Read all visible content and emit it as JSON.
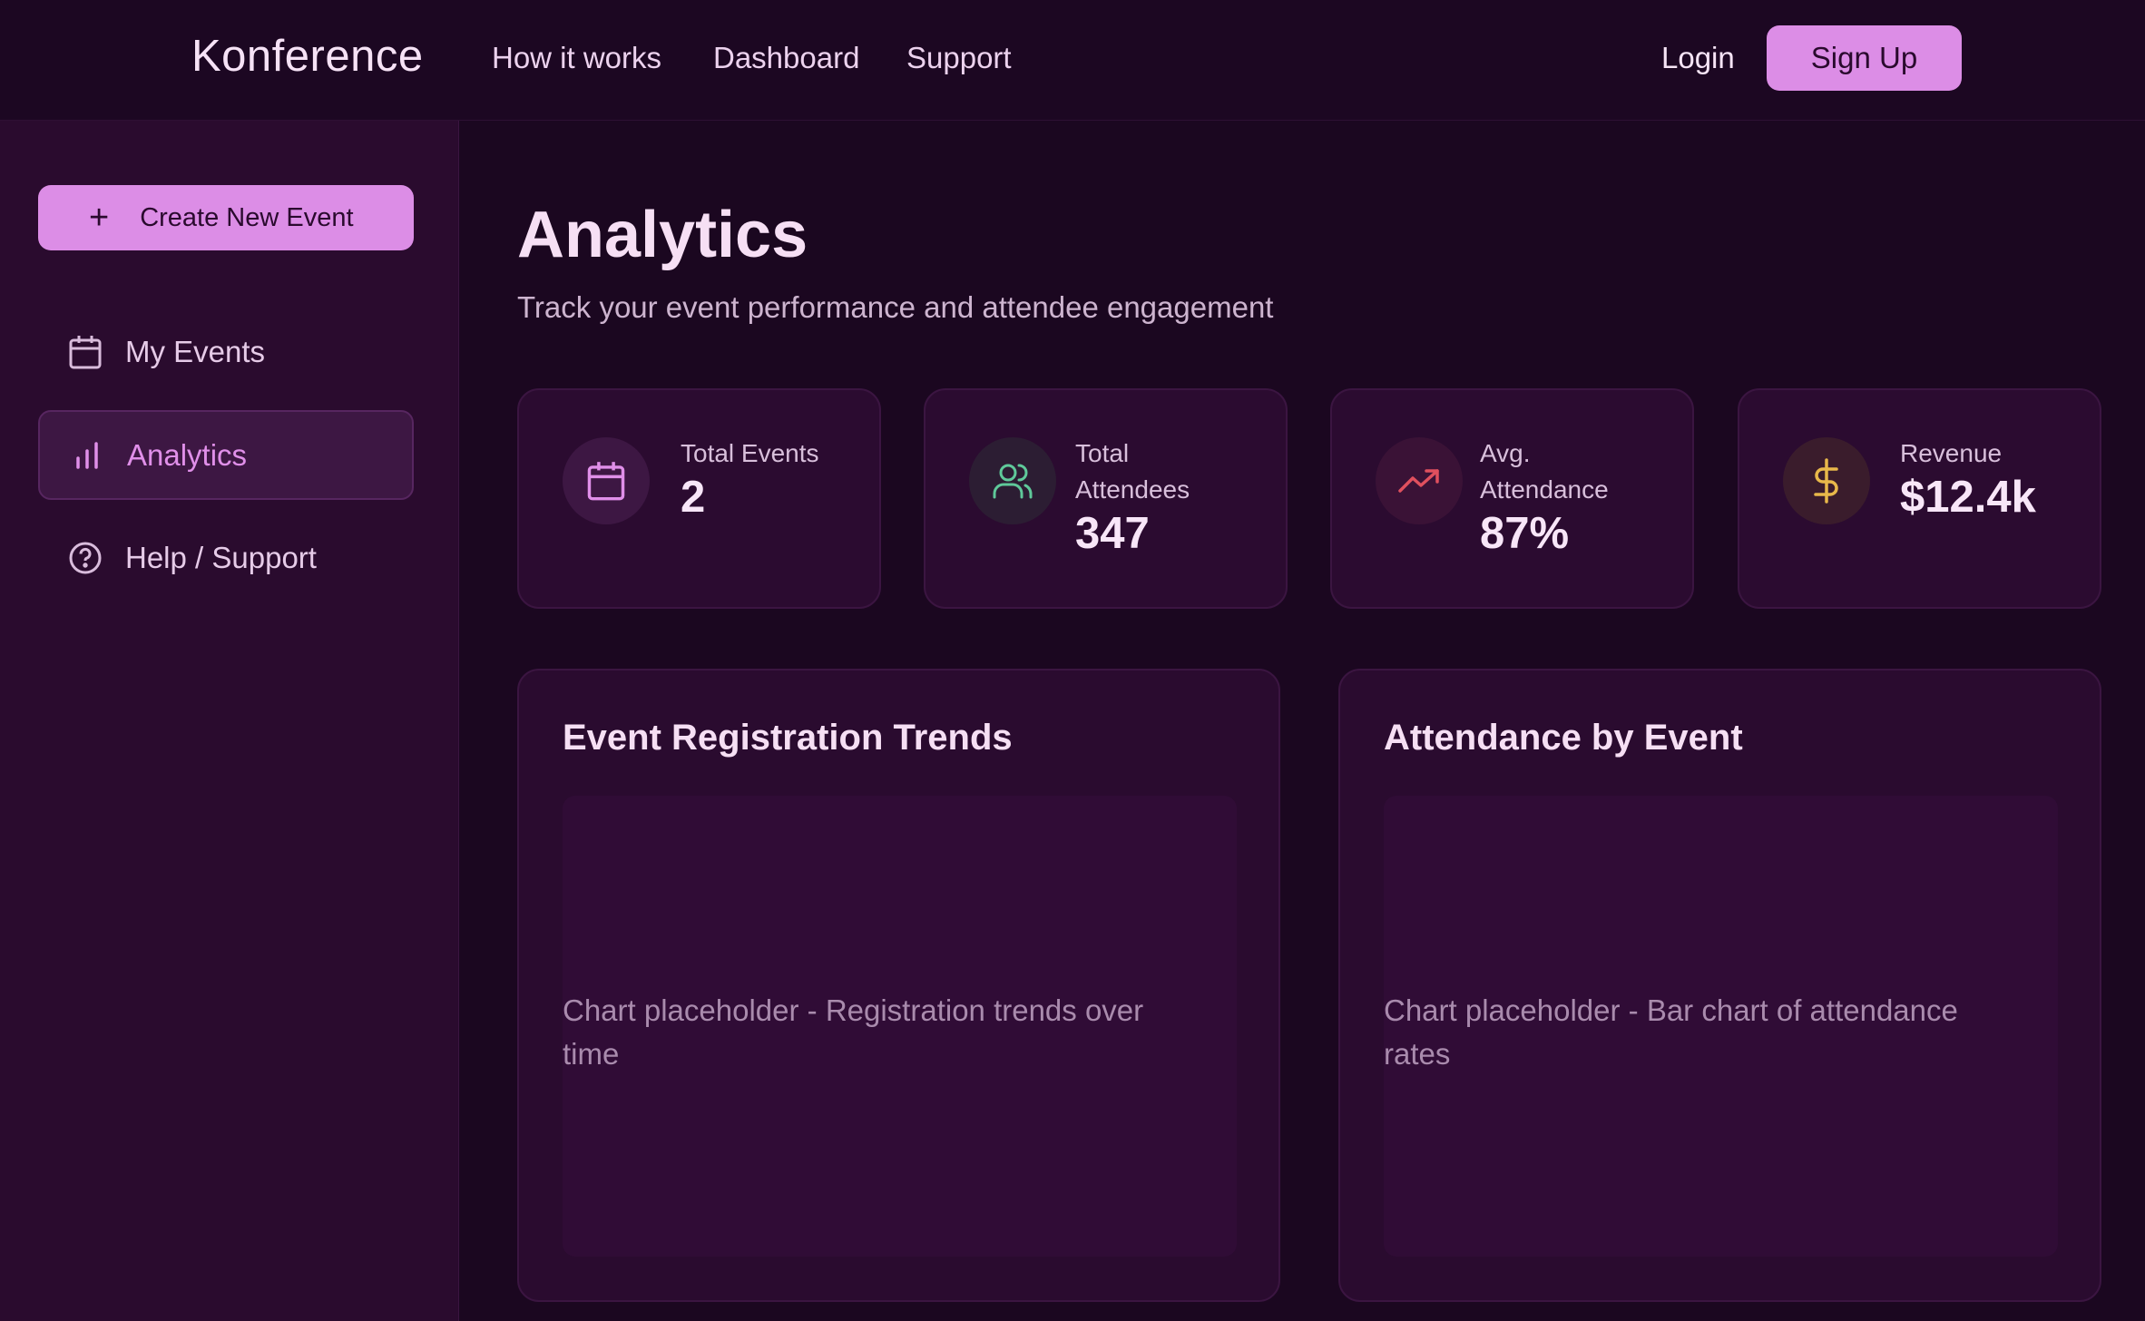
{
  "header": {
    "logo": "Konference",
    "nav": [
      "How it works",
      "Dashboard",
      "Support"
    ],
    "login": "Login",
    "signup": "Sign Up"
  },
  "sidebar": {
    "create_button": "Create New Event",
    "items": [
      {
        "label": "My Events",
        "icon": "calendar-icon",
        "active": false
      },
      {
        "label": "Analytics",
        "icon": "bar-chart-icon",
        "active": true
      },
      {
        "label": "Help / Support",
        "icon": "help-circle-icon",
        "active": false
      }
    ]
  },
  "main": {
    "title": "Analytics",
    "subtitle": "Track your event performance and attendee engagement",
    "stats": [
      {
        "label_line1": "Total Events",
        "label_line2": "",
        "value": "2",
        "icon": "calendar-icon",
        "color": "#e08fe9"
      },
      {
        "label_line1": "Total",
        "label_line2": "Attendees",
        "value": "347",
        "icon": "users-icon",
        "color": "#5fc99a"
      },
      {
        "label_line1": "Avg.",
        "label_line2": "Attendance",
        "value": "87%",
        "icon": "trending-up-icon",
        "color": "#e0505e"
      },
      {
        "label_line1": "Revenue",
        "label_line2": "",
        "value": "$12.4k",
        "icon": "dollar-icon",
        "color": "#e8b84a"
      }
    ],
    "panels": [
      {
        "title": "Event Registration Trends",
        "placeholder": "Chart placeholder - Registration trends over time"
      },
      {
        "title": "Attendance by Event",
        "placeholder": "Chart placeholder - Bar chart of attendance rates"
      }
    ]
  }
}
